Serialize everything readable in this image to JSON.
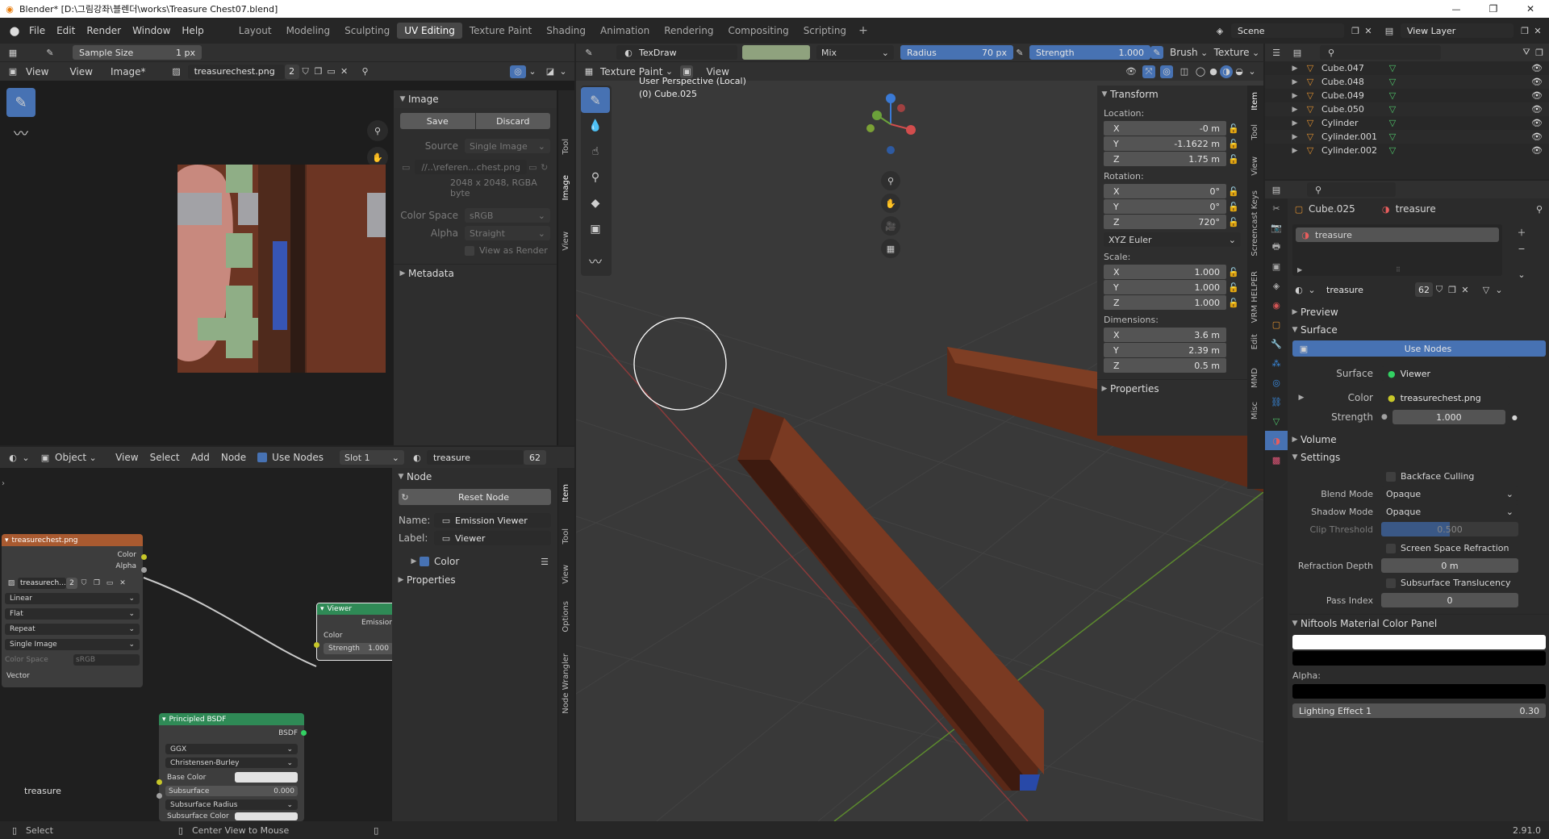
{
  "window": {
    "title": "Blender* [D:\\그림강좌\\블렌더\\works\\Treasure Chest07.blend]",
    "min": "—",
    "max": "❐",
    "close": "✕"
  },
  "menubar": {
    "items": [
      "File",
      "Edit",
      "Render",
      "Window",
      "Help"
    ]
  },
  "workspaces": [
    "Layout",
    "Modeling",
    "Sculpting",
    "UV Editing",
    "Texture Paint",
    "Shading",
    "Animation",
    "Rendering",
    "Compositing",
    "Scripting"
  ],
  "active_workspace": "UV Editing",
  "add_tab": "+",
  "scene": {
    "label": "Scene",
    "view_layer": "View Layer"
  },
  "image_editor": {
    "sample_size_label": "Sample Size",
    "sample_size_value": "1 px",
    "menus": [
      "View",
      "View",
      "Image*"
    ],
    "image_name": "treasurechest.png",
    "users": "2",
    "image_panel": {
      "title": "Image",
      "save": "Save",
      "discard": "Discard",
      "source_label": "Source",
      "source_value": "Single Image",
      "filepath": "//..\\referen...chest.png",
      "info": "2048 x 2048,  RGBA byte",
      "colorspace_label": "Color Space",
      "colorspace_value": "sRGB",
      "alpha_label": "Alpha",
      "alpha_value": "Straight",
      "view_as_render": "View as Render",
      "metadata": "Metadata"
    },
    "tabs": [
      "Tool",
      "Image",
      "View"
    ]
  },
  "node_editor": {
    "object_label": "Object",
    "menus": [
      "View",
      "Select",
      "Add",
      "Node"
    ],
    "use_nodes": "Use Nodes",
    "slot": "Slot 1",
    "material": "treasure",
    "mat_users": "62",
    "node_panel": {
      "title": "Node",
      "reset": "Reset Node",
      "name_label": "Name:",
      "name_value": "Emission Viewer",
      "label_label": "Label:",
      "label_value": "Viewer",
      "color": "Color",
      "properties": "Properties"
    },
    "tabs": [
      "Item",
      "Tool",
      "View",
      "Options",
      "Node Wrangler"
    ],
    "image_node": {
      "title": "treasurechest.png",
      "out_color": "Color",
      "out_alpha": "Alpha",
      "img": "treasurech...",
      "users": "2",
      "interp": "Linear",
      "proj": "Flat",
      "ext": "Repeat",
      "src": "Single Image",
      "cs_label": "Color Space",
      "cs_value": "sRGB",
      "vector": "Vector"
    },
    "viewer_node": {
      "title": "Viewer",
      "emission": "Emission",
      "color": "Color",
      "strength_label": "Strength",
      "strength_value": "1.000"
    },
    "bsdf_node": {
      "title": "Principled BSDF",
      "out": "BSDF",
      "dist": "GGX",
      "sss": "Christensen-Burley",
      "base_color": "Base Color",
      "subsurface": "Subsurface",
      "subsurface_val": "0.000",
      "subsurface_radius": "Subsurface Radius",
      "subsurface_color": "Subsurface Color"
    },
    "material_footer": "treasure"
  },
  "viewport": {
    "brush": "TexDraw",
    "blend": "Mix",
    "radius_label": "Radius",
    "radius_value": "70 px",
    "strength_label": "Strength",
    "strength_value": "1.000",
    "brush_menu": "Brush",
    "texture_menu": "Texture",
    "mode": "Texture Paint",
    "view_menu": "View",
    "perspective": "User Perspective (Local)",
    "object": "(0) Cube.025",
    "brush_color": "#8fa27e",
    "transform": {
      "title": "Transform",
      "location": "Location:",
      "loc": [
        [
          "X",
          "-0 m"
        ],
        [
          "Y",
          "-1.1622 m"
        ],
        [
          "Z",
          "1.75 m"
        ]
      ],
      "rotation": "Rotation:",
      "rot": [
        [
          "X",
          "0°"
        ],
        [
          "Y",
          "0°"
        ],
        [
          "Z",
          "720°"
        ]
      ],
      "euler": "XYZ Euler",
      "scale": "Scale:",
      "scl": [
        [
          "X",
          "1.000"
        ],
        [
          "Y",
          "1.000"
        ],
        [
          "Z",
          "1.000"
        ]
      ],
      "dimensions": "Dimensions:",
      "dims": [
        [
          "X",
          "3.6 m"
        ],
        [
          "Y",
          "2.39 m"
        ],
        [
          "Z",
          "0.5 m"
        ]
      ],
      "properties": "Properties"
    },
    "tabs": [
      "Item",
      "Tool",
      "View",
      "Screencast Keys",
      "VRM HELPER",
      "Edit",
      "MMD",
      "Misc"
    ]
  },
  "outliner": {
    "items": [
      {
        "name": "Cube.047",
        "ico": "mesh"
      },
      {
        "name": "Cube.048",
        "ico": "mesh"
      },
      {
        "name": "Cube.049",
        "ico": "mesh"
      },
      {
        "name": "Cube.050",
        "ico": "mesh"
      },
      {
        "name": "Cylinder",
        "ico": "mesh"
      },
      {
        "name": "Cylinder.001",
        "ico": "mesh"
      },
      {
        "name": "Cylinder.002",
        "ico": "mesh"
      }
    ]
  },
  "properties": {
    "object": "Cube.025",
    "material": "treasure",
    "slot_item": "treasure",
    "mat_name": "treasure",
    "mat_users": "62",
    "preview": "Preview",
    "surface": "Surface",
    "use_nodes": "Use Nodes",
    "surface_label": "Surface",
    "surface_value": "Viewer",
    "color_label": "Color",
    "color_value": "treasurechest.png",
    "strength_label": "Strength",
    "strength_value": "1.000",
    "volume": "Volume",
    "settings": "Settings",
    "backface": "Backface Culling",
    "blend_label": "Blend Mode",
    "blend_value": "Opaque",
    "shadow_label": "Shadow Mode",
    "shadow_value": "Opaque",
    "clip_label": "Clip Threshold",
    "clip_value": "0.500",
    "ssr": "Screen Space Refraction",
    "refr_label": "Refraction Depth",
    "refr_value": "0 m",
    "sst": "Subsurface Translucency",
    "pass_label": "Pass Index",
    "pass_value": "0",
    "niftools": "Niftools Material Color Panel",
    "alpha": "Alpha:",
    "lighting_label": "Lighting Effect 1",
    "lighting_value": "0.30"
  },
  "statusbar": {
    "select": "Select",
    "center": "Center View to Mouse",
    "version": "2.91.0"
  }
}
